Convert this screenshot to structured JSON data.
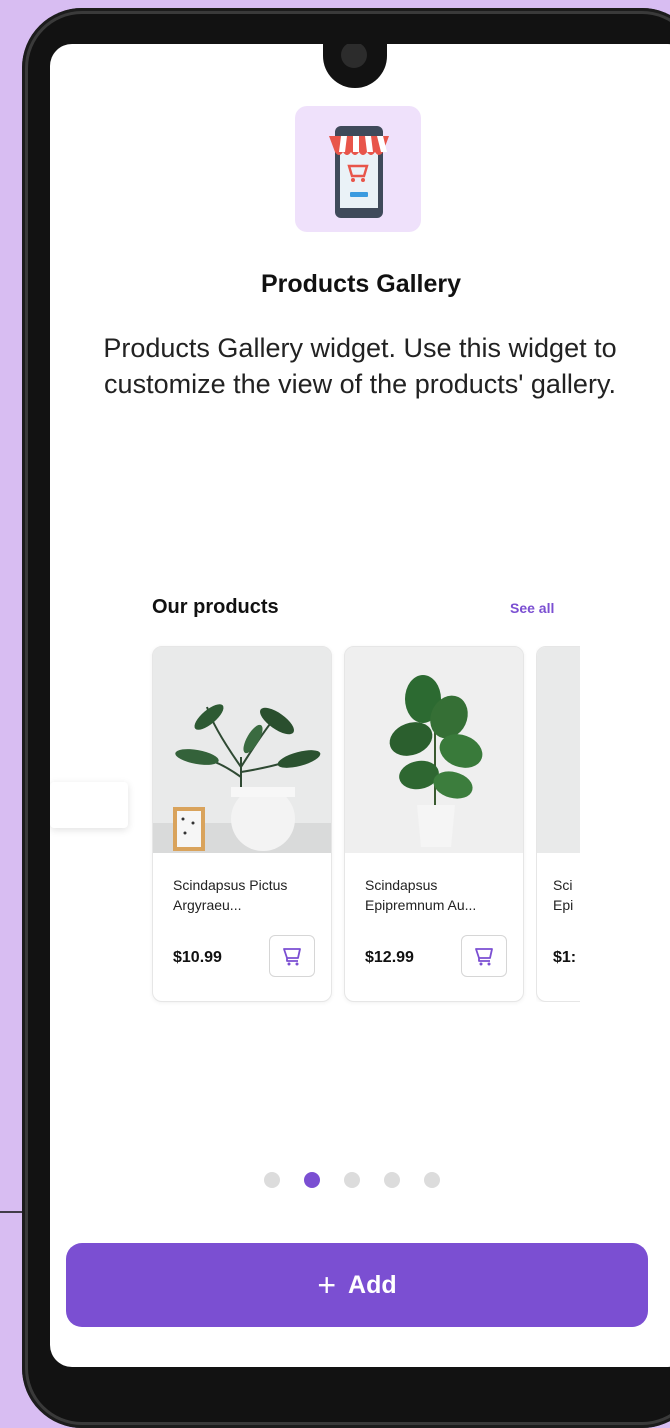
{
  "widget": {
    "title": "Products Gallery",
    "description": "Products Gallery widget. Use this widget to customize the view of the products' gallery.",
    "icon": "storefront-phone-icon"
  },
  "gallery": {
    "heading": "Our products",
    "see_all": "See all",
    "products": [
      {
        "name": "Scindapsus Pictus Argyraeu...",
        "price": "$10.99",
        "image": "plant-image"
      },
      {
        "name": "Scindapsus Epipremnum Au...",
        "price": "$12.99",
        "image": "fiddle-leaf-image"
      },
      {
        "name": "Sci Epi",
        "price": "$1:",
        "image": "plant-image"
      }
    ]
  },
  "carousel": {
    "total": 5,
    "active": 2
  },
  "add_button": {
    "icon": "+",
    "label": "Add"
  },
  "colors": {
    "accent": "#7b4fd2",
    "background": "#d8bdf2"
  }
}
